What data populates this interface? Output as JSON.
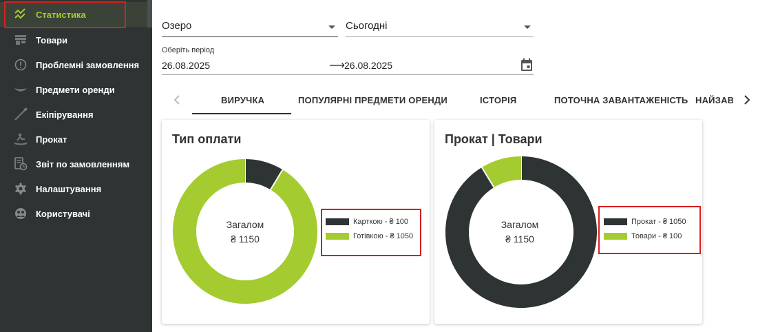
{
  "sidebar": {
    "items": [
      {
        "label": "Статистика",
        "icon": "chart-line-icon",
        "active": true
      },
      {
        "label": "Товари",
        "icon": "store-icon"
      },
      {
        "label": "Проблемні замовлення",
        "icon": "alert-circle-icon"
      },
      {
        "label": "Предмети оренди",
        "icon": "kayak-icon"
      },
      {
        "label": "Екіпірування",
        "icon": "paddle-icon"
      },
      {
        "label": "Прокат",
        "icon": "rowing-icon"
      },
      {
        "label": "Звіт по замовленням",
        "icon": "report-clock-icon"
      },
      {
        "label": "Налаштування",
        "icon": "gear-icon"
      },
      {
        "label": "Користувачі",
        "icon": "users-icon"
      }
    ]
  },
  "filters": {
    "location": "Озеро",
    "range": "Сьогодні",
    "period_label": "Оберіть період",
    "date_from": "26.08.2025",
    "date_to": "26.08.2025"
  },
  "tabs": [
    "ВИРУЧКА",
    "ПОПУЛЯРНІ ПРЕДМЕТИ ОРЕНДИ",
    "ІСТОРІЯ",
    "ПОТОЧНА ЗАВАНТАЖЕНІСТЬ",
    "НАЙЗАВАНТАЖЕНІШІ"
  ],
  "active_tab": 0,
  "colors": {
    "dark": "#2e3333",
    "accent": "#a4cc30",
    "highlight": "#d81f1f"
  },
  "cards": [
    {
      "title": "Тип оплати",
      "center_title": "Загалом",
      "center_value": "₴ 1150",
      "legend": [
        "Карткою - ₴ 100",
        "Готівкою - ₴ 1050"
      ]
    },
    {
      "title": "Прокат | Товари",
      "center_title": "Загалом",
      "center_value": "₴ 1150",
      "legend": [
        "Прокат - ₴ 1050",
        "Товари - ₴ 100"
      ]
    }
  ],
  "chart_data": [
    {
      "type": "pie",
      "title": "Тип оплати",
      "categories": [
        "Карткою",
        "Готівкою"
      ],
      "values": [
        100,
        1050
      ],
      "colors": [
        "#2e3333",
        "#a4cc30"
      ],
      "total": 1150,
      "legend_position": "right"
    },
    {
      "type": "pie",
      "title": "Прокат | Товари",
      "categories": [
        "Прокат",
        "Товари"
      ],
      "values": [
        1050,
        100
      ],
      "colors": [
        "#2e3333",
        "#a4cc30"
      ],
      "total": 1150,
      "legend_position": "right"
    }
  ]
}
